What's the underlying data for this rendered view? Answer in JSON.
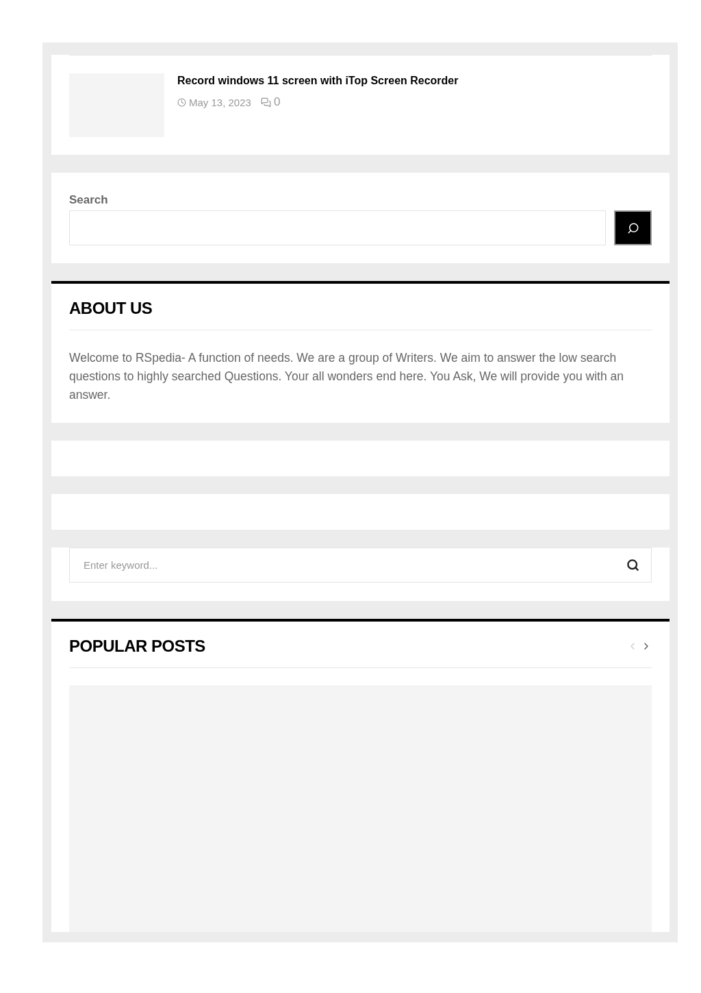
{
  "recent_post": {
    "title": "Record windows 11 screen with iTop Screen Recorder",
    "date": "May 13, 2023",
    "comments": "0"
  },
  "search_widget": {
    "label": "Search"
  },
  "about": {
    "heading": "ABOUT US",
    "text": "Welcome to RSpedia- A function of needs. We are a group of Writers. We aim to answer the low search questions to highly searched Questions. Your all wonders end here. You Ask, We will provide you with an answer."
  },
  "keyword_search": {
    "placeholder": "Enter keyword..."
  },
  "popular": {
    "heading": "POPULAR POSTS",
    "nav": [
      {
        "kind": "prev",
        "disabled": true
      },
      {
        "kind": "next",
        "disabled": false
      }
    ]
  }
}
